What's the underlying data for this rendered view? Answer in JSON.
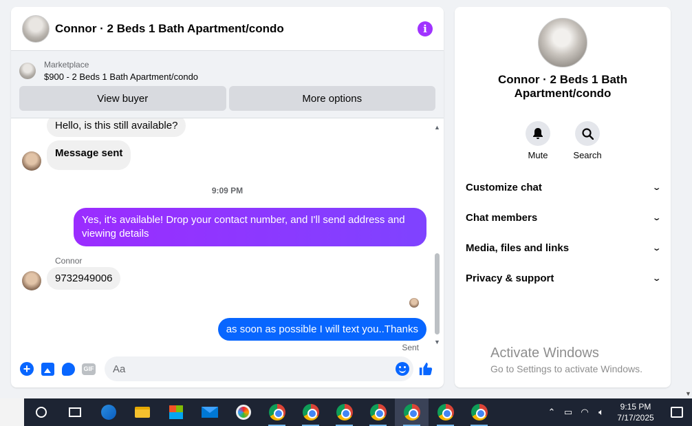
{
  "chat": {
    "title": "Connor · 2 Beds 1 Bath Apartment/condo",
    "marketplace": {
      "label": "Marketplace",
      "listing": "$900 - 2 Beds 1 Bath Apartment/condo",
      "view_buyer": "View buyer",
      "more_options": "More options"
    },
    "messages": {
      "in_1": "Hello, is this still available?",
      "in_2": "Message sent",
      "time": "9:09 PM",
      "out_1": "Yes, it's available! Drop your contact number, and I'll send address and viewing details",
      "sender": "Connor",
      "in_3": "9732949006",
      "out_2": "as soon as possible I will text you..Thanks",
      "status": "Sent"
    },
    "composer": {
      "placeholder": "Aa",
      "gif_label": "GIF"
    },
    "colors": {
      "accent": "#0866ff",
      "gradient_start": "#9b2cff",
      "gradient_end": "#7f43ff"
    }
  },
  "info": {
    "title": "Connor · 2 Beds 1 Bath Apartment/condo",
    "mute": "Mute",
    "search": "Search",
    "items": [
      "Customize chat",
      "Chat members",
      "Media, files and links",
      "Privacy & support"
    ],
    "watermark_1": "Activate Windows",
    "watermark_2": "Go to Settings to activate Windows."
  },
  "taskbar": {
    "time": "9:15 PM",
    "date": "7/17/2025"
  }
}
